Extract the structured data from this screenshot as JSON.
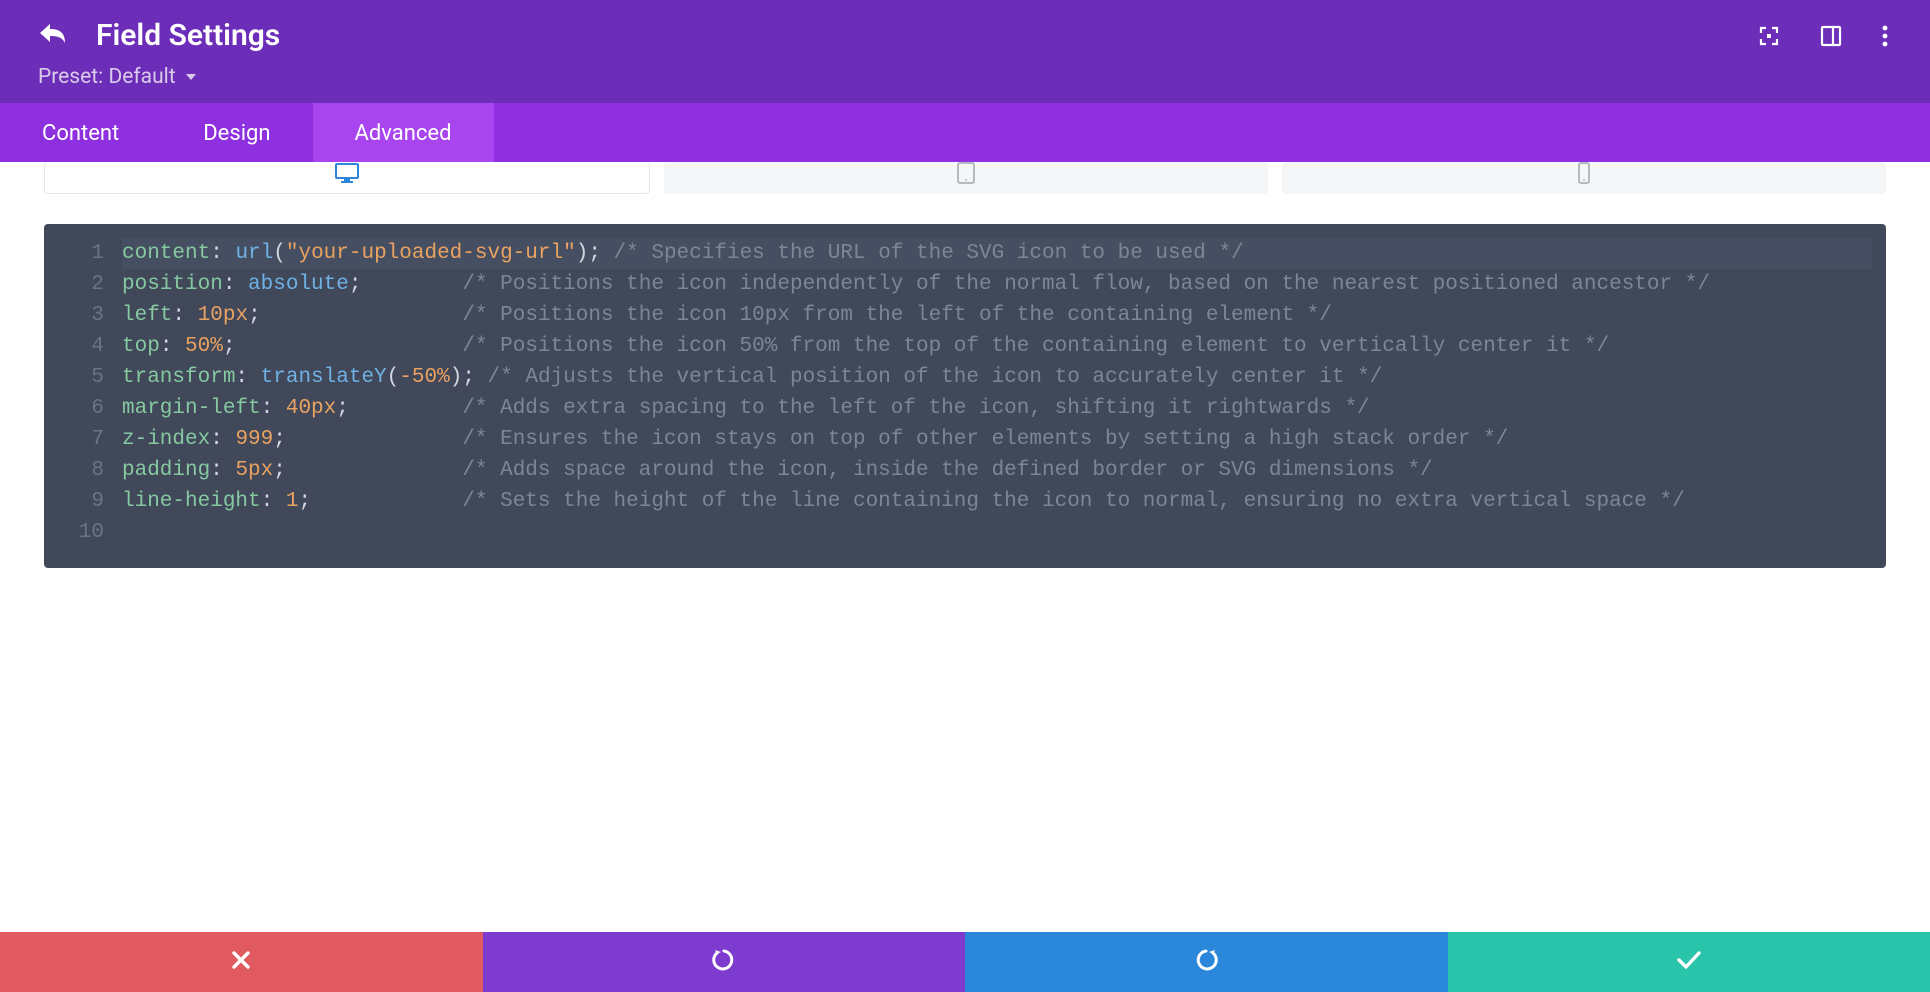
{
  "header": {
    "title": "Field Settings",
    "preset_label": "Preset: Default"
  },
  "tabs": {
    "content": "Content",
    "design": "Design",
    "advanced": "Advanced",
    "active": "Advanced"
  },
  "code_lines": [
    {
      "n": 1,
      "hl": true,
      "tokens": [
        {
          "t": "content",
          "c": "prop"
        },
        {
          "t": ": ",
          "c": "punc"
        },
        {
          "t": "url",
          "c": "func"
        },
        {
          "t": "(",
          "c": "punc"
        },
        {
          "t": "\"your-uploaded-svg-url\"",
          "c": "str"
        },
        {
          "t": ")",
          "c": "punc"
        },
        {
          "t": ";",
          "c": "punc"
        },
        {
          "t": " ",
          "c": ""
        },
        {
          "t": "/* Specifies the URL of the SVG icon to be used */",
          "c": "comment"
        }
      ]
    },
    {
      "n": 2,
      "tokens": [
        {
          "t": "position",
          "c": "prop"
        },
        {
          "t": ": ",
          "c": "punc"
        },
        {
          "t": "absolute",
          "c": "val"
        },
        {
          "t": ";",
          "c": "punc"
        },
        {
          "t": "        ",
          "c": ""
        },
        {
          "t": "/* Positions the icon independently of the normal flow, based on the nearest positioned ancestor */",
          "c": "comment"
        }
      ]
    },
    {
      "n": 3,
      "tokens": [
        {
          "t": "left",
          "c": "prop"
        },
        {
          "t": ": ",
          "c": "punc"
        },
        {
          "t": "10px",
          "c": "num"
        },
        {
          "t": ";",
          "c": "punc"
        },
        {
          "t": "                ",
          "c": ""
        },
        {
          "t": "/* Positions the icon 10px from the left of the containing element */",
          "c": "comment"
        }
      ]
    },
    {
      "n": 4,
      "tokens": [
        {
          "t": "top",
          "c": "prop"
        },
        {
          "t": ": ",
          "c": "punc"
        },
        {
          "t": "50%",
          "c": "num"
        },
        {
          "t": ";",
          "c": "punc"
        },
        {
          "t": "                  ",
          "c": ""
        },
        {
          "t": "/* Positions the icon 50% from the top of the containing element to vertically center it */",
          "c": "comment"
        }
      ]
    },
    {
      "n": 5,
      "tokens": [
        {
          "t": "transform",
          "c": "prop"
        },
        {
          "t": ": ",
          "c": "punc"
        },
        {
          "t": "translateY",
          "c": "func"
        },
        {
          "t": "(",
          "c": "punc"
        },
        {
          "t": "-50%",
          "c": "num"
        },
        {
          "t": ")",
          "c": "punc"
        },
        {
          "t": ";",
          "c": "punc"
        },
        {
          "t": " ",
          "c": ""
        },
        {
          "t": "/* Adjusts the vertical position of the icon to accurately center it */",
          "c": "comment"
        }
      ]
    },
    {
      "n": 6,
      "tokens": [
        {
          "t": "margin-left",
          "c": "prop"
        },
        {
          "t": ": ",
          "c": "punc"
        },
        {
          "t": "40px",
          "c": "num"
        },
        {
          "t": ";",
          "c": "punc"
        },
        {
          "t": "         ",
          "c": ""
        },
        {
          "t": "/* Adds extra spacing to the left of the icon, shifting it rightwards */",
          "c": "comment"
        }
      ]
    },
    {
      "n": 7,
      "tokens": [
        {
          "t": "z-index",
          "c": "prop"
        },
        {
          "t": ": ",
          "c": "punc"
        },
        {
          "t": "999",
          "c": "num"
        },
        {
          "t": ";",
          "c": "punc"
        },
        {
          "t": "              ",
          "c": ""
        },
        {
          "t": "/* Ensures the icon stays on top of other elements by setting a high stack order */",
          "c": "comment"
        }
      ]
    },
    {
      "n": 8,
      "tokens": [
        {
          "t": "padding",
          "c": "prop"
        },
        {
          "t": ": ",
          "c": "punc"
        },
        {
          "t": "5px",
          "c": "num"
        },
        {
          "t": ";",
          "c": "punc"
        },
        {
          "t": "              ",
          "c": ""
        },
        {
          "t": "/* Adds space around the icon, inside the defined border or SVG dimensions */",
          "c": "comment"
        }
      ]
    },
    {
      "n": 9,
      "tokens": [
        {
          "t": "line-height",
          "c": "prop"
        },
        {
          "t": ": ",
          "c": "punc"
        },
        {
          "t": "1",
          "c": "num"
        },
        {
          "t": ";",
          "c": "punc"
        },
        {
          "t": "            ",
          "c": ""
        },
        {
          "t": "/* Sets the height of the line containing the icon to normal, ensuring no extra vertical space */",
          "c": "comment"
        }
      ]
    },
    {
      "n": 10,
      "tokens": []
    }
  ],
  "footer": {
    "cancel": "cancel",
    "undo": "undo",
    "redo": "redo",
    "save": "save"
  }
}
